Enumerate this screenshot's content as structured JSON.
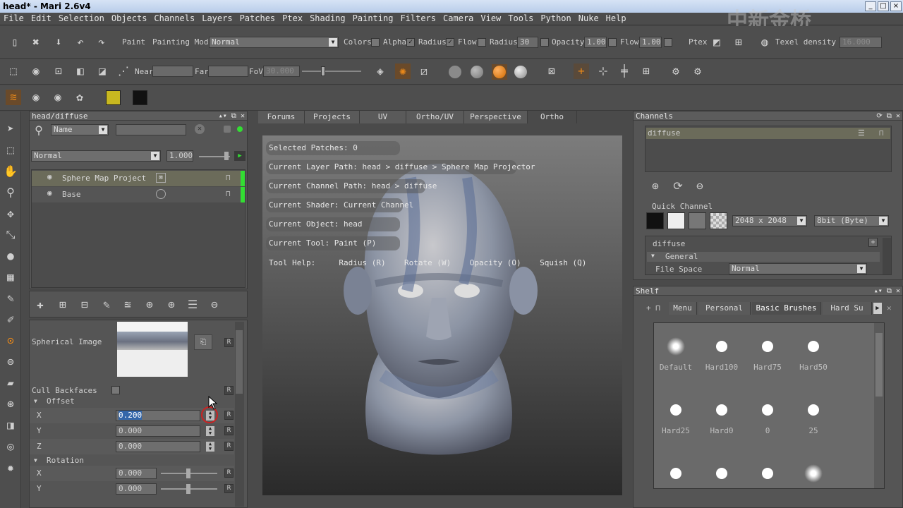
{
  "window": {
    "title": "head* - Mari 2.6v4",
    "watermark": "中新金桥"
  },
  "menu": [
    "File",
    "Edit",
    "Selection",
    "Objects",
    "Channels",
    "Layers",
    "Patches",
    "Ptex",
    "Shading",
    "Painting",
    "Filters",
    "Camera",
    "View",
    "Tools",
    "Python",
    "Nuke",
    "Help"
  ],
  "toolbar1": {
    "paint_label": "Paint",
    "painting_mode_label": "Painting Mode",
    "painting_mode_value": "Normal",
    "colors_label": "Colors",
    "alpha_label": "Alpha",
    "radius_check_label": "Radius",
    "flow_check_label": "Flow",
    "radius_label": "Radius",
    "radius_value": "30",
    "opacity_label": "Opacity",
    "opacity_value": "1.000",
    "flow_label": "Flow",
    "flow_value": "1.000",
    "ptex_label": "Ptex",
    "texel_label": "Texel density :",
    "texel_value": "16.000"
  },
  "toolbar2": {
    "near_label": "Near",
    "far_label": "Far",
    "fov_label": "FoV",
    "fov_value": "30.000"
  },
  "layers_panel": {
    "title": "head/diffuse",
    "filter_value": "Name",
    "blend_mode": "Normal",
    "opacity": "1.000",
    "layers": [
      {
        "name": "Sphere Map Project",
        "selected": true
      },
      {
        "name": "Base",
        "selected": false
      }
    ]
  },
  "properties": {
    "spherical_image_label": "Spherical Image",
    "cull_label": "Cull Backfaces",
    "offset_label": "Offset",
    "offset": [
      {
        "axis": "X",
        "value": "0.200"
      },
      {
        "axis": "Y",
        "value": "0.000"
      },
      {
        "axis": "Z",
        "value": "0.000"
      }
    ],
    "rotation_label": "Rotation",
    "rotation": [
      {
        "axis": "X",
        "value": "0.000"
      },
      {
        "axis": "Y",
        "value": "0.000"
      }
    ],
    "reset_label": "R"
  },
  "viewport": {
    "tabs": [
      "Forums",
      "Projects",
      "UV",
      "Ortho/UV",
      "Perspective",
      "Ortho"
    ],
    "active_tab": "Ortho",
    "info": [
      "Selected Patches: 0",
      "Current Layer Path: head > diffuse > Sphere Map Projector",
      "Current Channel Path: head > diffuse",
      "Current Shader: Current Channel",
      "Current Object: head",
      "Current Tool: Paint (P)"
    ],
    "tool_help": "Tool Help:     Radius (R)    Rotate (W)    Opacity (O)    Squish (Q)"
  },
  "channels_panel": {
    "title": "Channels",
    "channel": "diffuse",
    "quick_channel_label": "Quick Channel",
    "resolution": "2048 x 2048",
    "depth": "8bit (Byte)",
    "section": "diffuse",
    "general_label": "General",
    "file_space_label": "File Space",
    "file_space_value": "Normal"
  },
  "shelf_panel": {
    "title": "Shelf",
    "tabs": [
      "Menu",
      "Personal",
      "Basic Brushes",
      "Hard Su"
    ],
    "active_tab": "Basic Brushes",
    "brushes": [
      {
        "name": "Default",
        "soft": true
      },
      {
        "name": "Hard100",
        "soft": false
      },
      {
        "name": "Hard75",
        "soft": false
      },
      {
        "name": "Hard50",
        "soft": false
      },
      {
        "name": "Hard25",
        "soft": false
      },
      {
        "name": "Hard0",
        "soft": false
      },
      {
        "name": "0",
        "soft": false
      },
      {
        "name": "25",
        "soft": false
      },
      {
        "name": "",
        "soft": false
      },
      {
        "name": "",
        "soft": false
      },
      {
        "name": "",
        "soft": false
      },
      {
        "name": "",
        "soft": true
      }
    ]
  },
  "colors": {
    "fg_swatch": "#c8b820",
    "bg_swatch": "#111111",
    "accent": "#e8881a",
    "layer_bar": "#33dd33"
  }
}
